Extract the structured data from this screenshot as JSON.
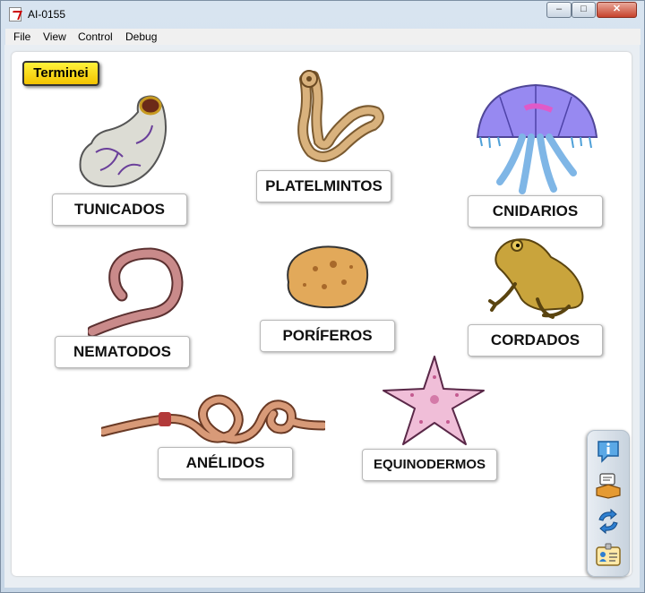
{
  "window": {
    "title": "AI-0155",
    "minimize_glyph": "–",
    "maximize_glyph": "□",
    "close_glyph": "✕"
  },
  "menu": [
    "File",
    "View",
    "Control",
    "Debug"
  ],
  "done_button": "Terminei",
  "cards": {
    "tunicados": "TUNICADOS",
    "platelmintos": "PLATELMINTOS",
    "cnidarios": "CNIDARIOS",
    "nematodos": "NEMATODOS",
    "poriferos": "PORÍFEROS",
    "cordados": "CORDADOS",
    "anelidos": "ANÉLIDOS",
    "equinodermos": "EQUINODERMOS"
  },
  "sidebar_icons": [
    "info-icon",
    "notes-book-icon",
    "refresh-icon",
    "credits-card-icon"
  ],
  "colors": {
    "done_button": "#f7d800",
    "panel": "#ffffff"
  }
}
